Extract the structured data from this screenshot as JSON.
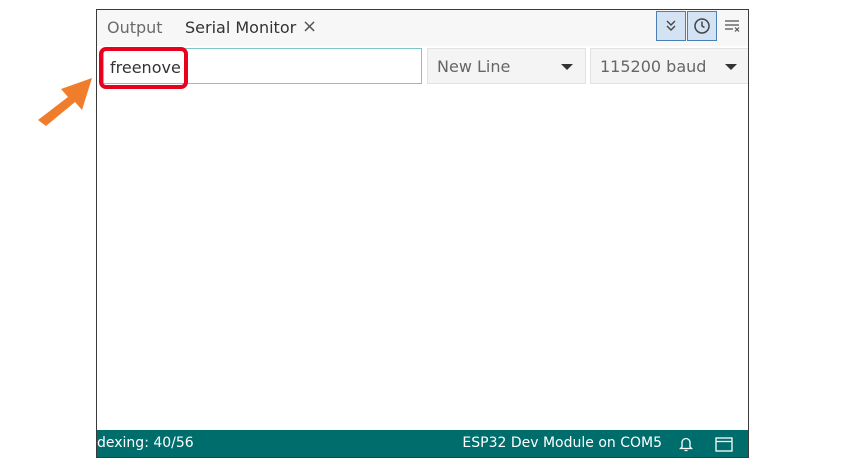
{
  "tabs": {
    "output_label": "Output",
    "serial_label": "Serial Monitor",
    "close_glyph": "×"
  },
  "toolbar": {
    "autoscroll_icon": "chevron-double-down-icon",
    "timestamp_icon": "clock-icon",
    "clear_icon": "clear-output-icon"
  },
  "input": {
    "value": "freenove",
    "placeholder": ""
  },
  "line_ending": {
    "selected": "New Line"
  },
  "baud_rate": {
    "selected": "115200 baud"
  },
  "status": {
    "indexing": "dexing: 40/56",
    "board": "ESP32 Dev Module on COM5"
  },
  "colors": {
    "statusbar": "#006d6d",
    "highlight": "#e8001c",
    "arrow": "#ef7d2b",
    "active_toggle_border": "#4a7fb5"
  }
}
